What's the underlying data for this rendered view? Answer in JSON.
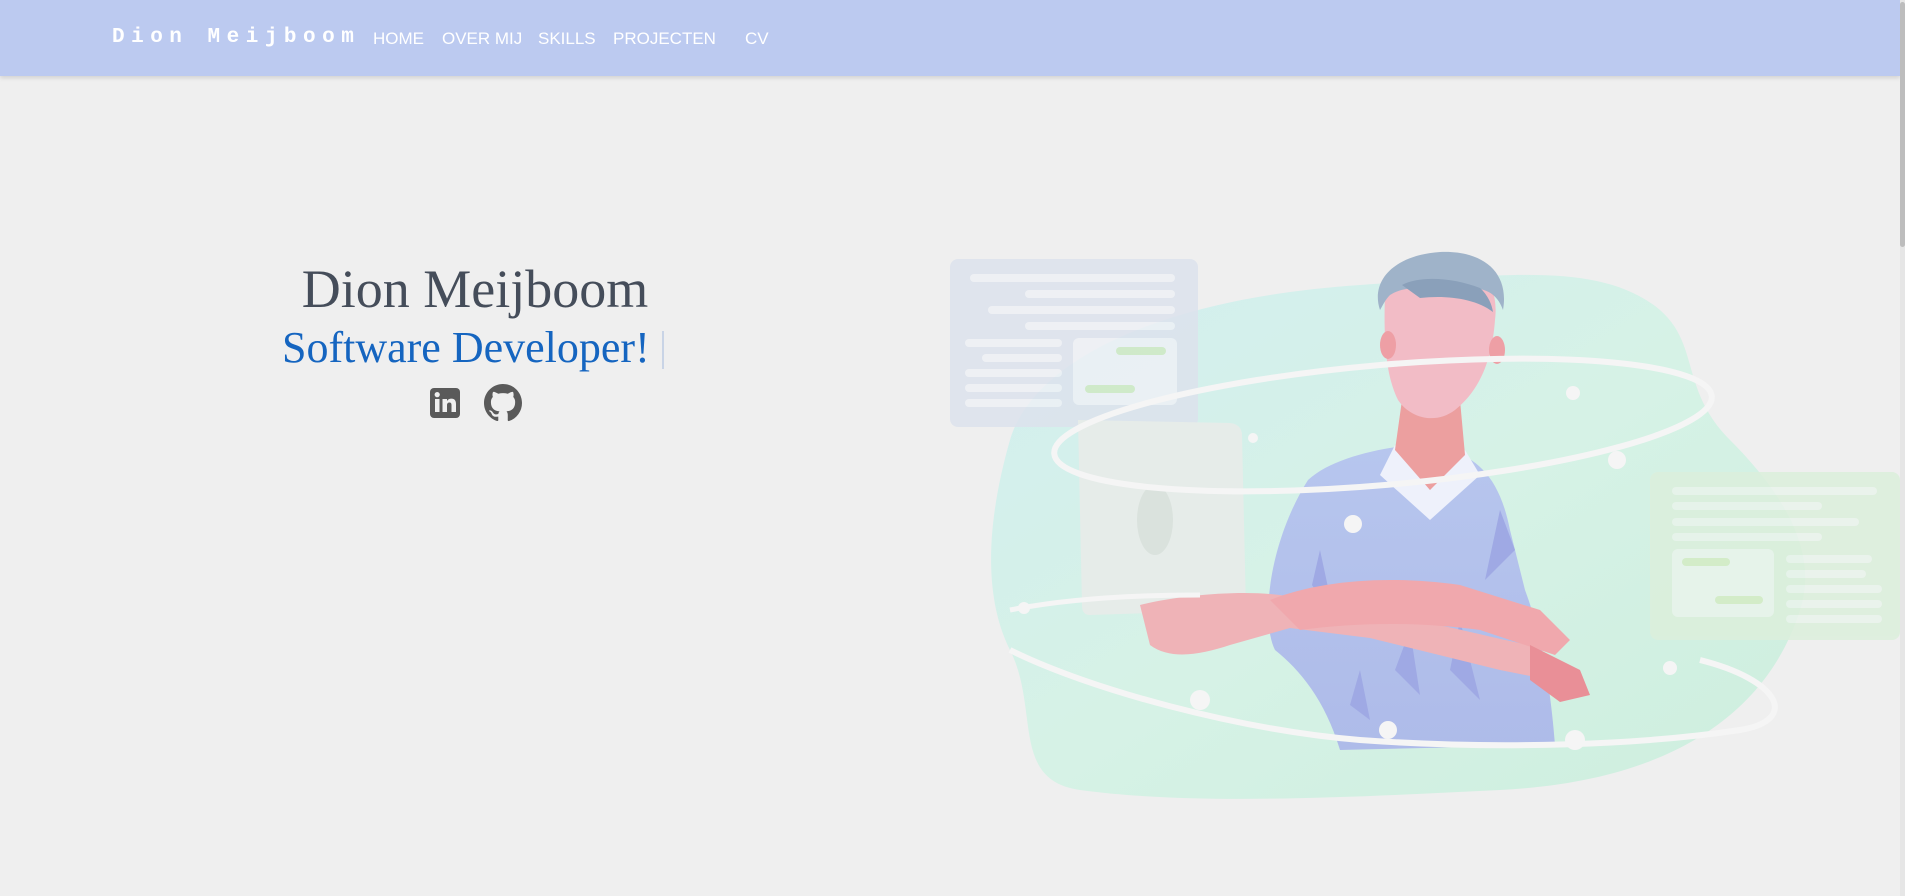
{
  "navbar": {
    "brand": "Dion Meijboom",
    "links": [
      {
        "label": "HOME"
      },
      {
        "label": "OVER MIJ"
      },
      {
        "label": "SKILLS"
      },
      {
        "label": "PROJECTEN"
      },
      {
        "label": "CV"
      }
    ],
    "background_color": "#bccaf0"
  },
  "hero": {
    "name": "Dion Meijboom",
    "role": "Software Developer!",
    "socials": [
      {
        "icon": "linkedin-icon"
      },
      {
        "icon": "github-icon"
      }
    ],
    "illustration": "developer-with-laptop-illustration"
  },
  "colors": {
    "page_background": "#efefef",
    "name_text": "#454d5a",
    "role_text": "#1565c0",
    "icon": "#5a5a5a"
  }
}
